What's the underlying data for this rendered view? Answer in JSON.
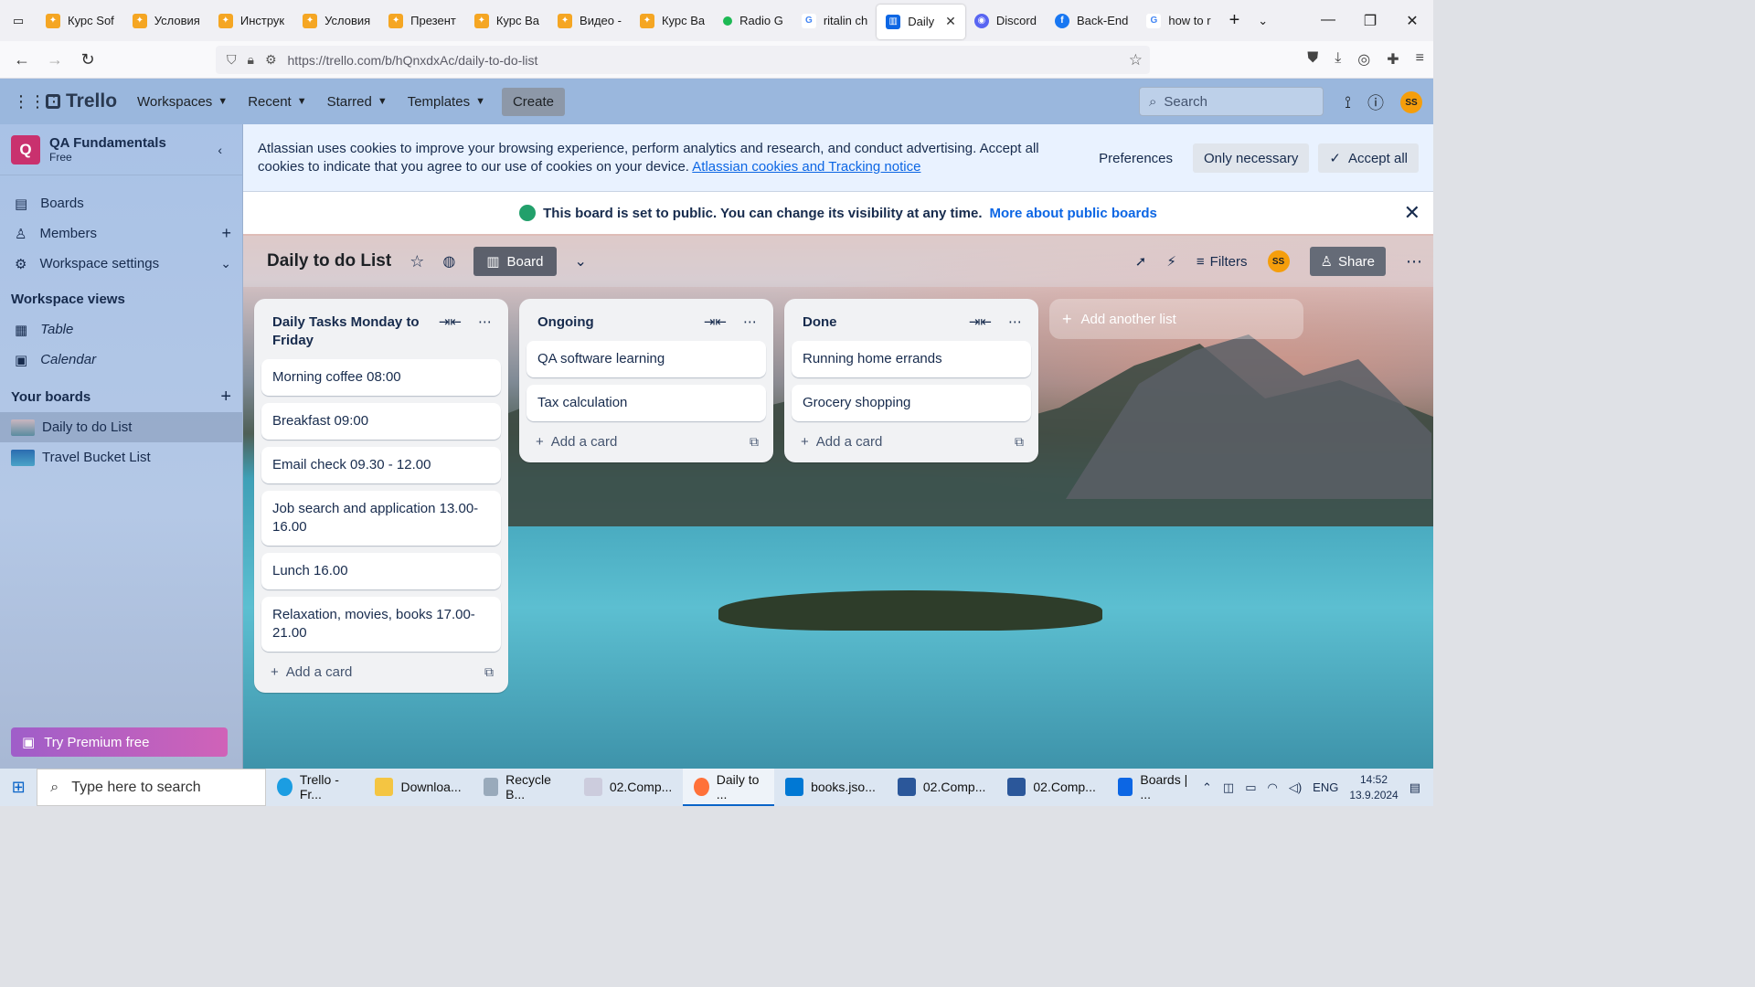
{
  "browser": {
    "tabs": [
      {
        "title": "Курс Sof",
        "color": "#f5a623"
      },
      {
        "title": "Условия",
        "color": "#f5a623"
      },
      {
        "title": "Инструк",
        "color": "#f5a623"
      },
      {
        "title": "Условия",
        "color": "#f5a623"
      },
      {
        "title": "Презент",
        "color": "#f5a623"
      },
      {
        "title": "Курс Ва",
        "color": "#f5a623"
      },
      {
        "title": "Видео -",
        "color": "#f5a623"
      },
      {
        "title": "Курс Ва",
        "color": "#f5a623"
      },
      {
        "title": "Radio G",
        "color": "#1db954"
      },
      {
        "title": "ritalin ch",
        "color": "#4285f4"
      }
    ],
    "active_tab": "Daily",
    "tabs_after": [
      {
        "title": "Discord",
        "color": "#5865f2"
      },
      {
        "title": "Back-End",
        "color": "#1877f2"
      },
      {
        "title": "how to r",
        "color": "#4285f4"
      }
    ],
    "url": "https://trello.com/b/hQnxdxAc/daily-to-do-list"
  },
  "header": {
    "logo": "Trello",
    "menu": [
      "Workspaces",
      "Recent",
      "Starred",
      "Templates"
    ],
    "create": "Create",
    "search_placeholder": "Search",
    "avatar": "SS"
  },
  "sidebar": {
    "workspace_initial": "Q",
    "workspace_name": "QA Fundamentals",
    "workspace_plan": "Free",
    "items": [
      "Boards",
      "Members",
      "Workspace settings"
    ],
    "views_heading": "Workspace views",
    "views": [
      "Table",
      "Calendar"
    ],
    "boards_heading": "Your boards",
    "boards": [
      "Daily to do List",
      "Travel Bucket List"
    ],
    "premium": "Try Premium free"
  },
  "cookie": {
    "text": "Atlassian uses cookies to improve your browsing experience, perform analytics and research, and conduct advertising. Accept all cookies to indicate that you agree to our use of cookies on your device.",
    "link": "Atlassian cookies and Tracking notice",
    "preferences": "Preferences",
    "only_necessary": "Only necessary",
    "accept_all": "Accept all"
  },
  "public_banner": {
    "text": "This board is set to public. You can change its visibility at any time.",
    "link": "More about public boards"
  },
  "board": {
    "title": "Daily to do List",
    "view": "Board",
    "filters": "Filters",
    "avatar": "SS",
    "share": "Share",
    "add_card": "Add a card",
    "add_list": "Add another list",
    "lists": [
      {
        "title": "Daily Tasks Monday to Friday",
        "cards": [
          "Morning coffee 08:00",
          "Breakfast 09:00",
          "Email check 09.30 - 12.00",
          "Job search and application 13.00-16.00",
          "Lunch 16.00",
          "Relaxation, movies, books 17.00-21.00"
        ]
      },
      {
        "title": "Ongoing",
        "cards": [
          "QA software learning",
          "Tax calculation"
        ]
      },
      {
        "title": "Done",
        "cards": [
          "Running home errands",
          "Grocery shopping"
        ]
      }
    ]
  },
  "taskbar": {
    "search": "Type here to search",
    "apps": [
      "Trello - Fr...",
      "Downloa...",
      "Recycle B...",
      "02.Comp...",
      "Daily to ...",
      "books.jso...",
      "02.Comp...",
      "02.Comp...",
      "Boards | ..."
    ],
    "lang": "ENG",
    "time": "14:52",
    "date": "13.9.2024"
  }
}
